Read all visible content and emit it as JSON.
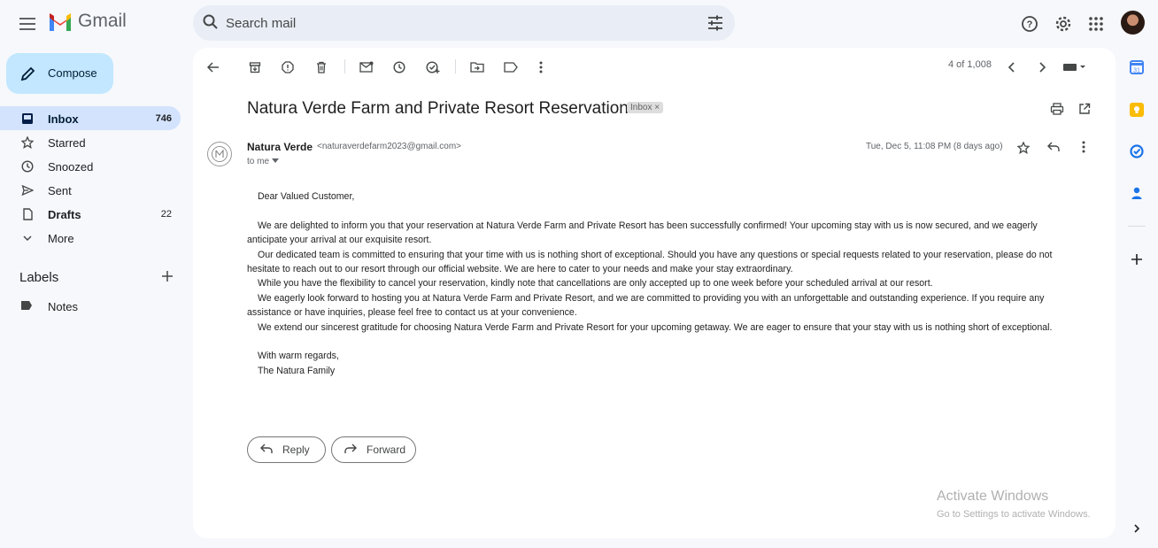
{
  "app": {
    "name": "Gmail"
  },
  "search": {
    "placeholder": "Search mail"
  },
  "compose": {
    "label": "Compose"
  },
  "nav": [
    {
      "label": "Inbox",
      "count": "746",
      "icon": "inbox-icon",
      "active": true
    },
    {
      "label": "Starred",
      "count": "",
      "icon": "star-icon"
    },
    {
      "label": "Snoozed",
      "count": "",
      "icon": "clock-icon"
    },
    {
      "label": "Sent",
      "count": "",
      "icon": "send-icon"
    },
    {
      "label": "Drafts",
      "count": "22",
      "icon": "draft-icon"
    },
    {
      "label": "More",
      "count": "",
      "icon": "chevron-down-icon"
    }
  ],
  "labels": {
    "heading": "Labels",
    "items": [
      {
        "label": "Notes",
        "icon": "label-icon"
      }
    ]
  },
  "toolbar": {
    "pager": "4 of 1,008"
  },
  "email": {
    "subject": "Natura Verde Farm and Private Resort Reservation",
    "badge": "Inbox",
    "sender_name": "Natura Verde",
    "sender_email": "<naturaverdefarm2023@gmail.com>",
    "to": "to me",
    "date": "Tue, Dec 5, 11:08 PM (8 days ago)",
    "greeting": "Dear Valued Customer,",
    "p1a": "We are delighted to inform you that your reservation at Natura Verde Farm and Private Resort has been successfully confirmed! Your upcoming stay with us is now secured, and we eagerly",
    "p1b": "anticipate your arrival at our exquisite resort.",
    "p2a": "Our dedicated team is committed to ensuring that your time with us is nothing short of exceptional. Should you have any questions or special requests related to your reservation, please do not",
    "p2b": "hesitate to reach out to our resort through our official website. We are here to cater to your needs and make your stay extraordinary.",
    "p3": "While you have the flexibility to cancel your reservation, kindly note that cancellations are only accepted up to one week before your scheduled arrival at our resort.",
    "p4a": "We eagerly look forward to hosting you at Natura Verde Farm and Private Resort, and we are committed to providing you with an unforgettable and outstanding experience. If you require any",
    "p4b": "assistance or have inquiries, please feel free to contact us at your convenience.",
    "p5": "We extend our sincerest gratitude for choosing Natura Verde Farm and Private Resort for your upcoming getaway. We are eager to ensure that your stay with us is nothing short of exceptional.",
    "closing": "With warm regards,",
    "signature": "The Natura Family"
  },
  "actions": {
    "reply": "Reply",
    "forward": "Forward"
  },
  "watermark": {
    "line1": "Activate Windows",
    "line2": "Go to Settings to activate Windows."
  },
  "colors": {
    "accent": "#0b57d0",
    "compose_bg": "#c2e7ff",
    "active_nav": "#d3e3fd",
    "page_bg": "#f6f8fc"
  }
}
